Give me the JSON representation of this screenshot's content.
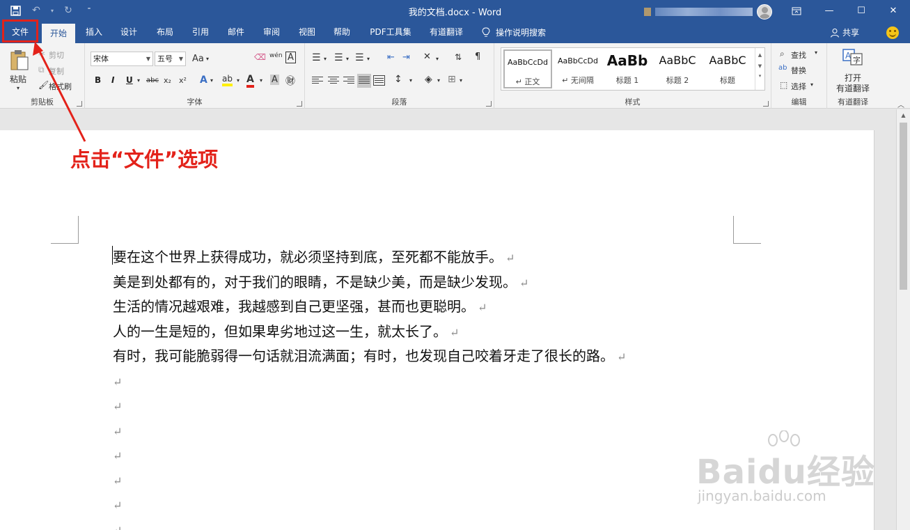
{
  "title_bar": {
    "document_title": "我的文档.docx - Word",
    "restore_icon": "ribbon-display-icon",
    "minimize": "—",
    "maximize": "☐",
    "close": "✕"
  },
  "tabs": [
    "文件",
    "开始",
    "插入",
    "设计",
    "布局",
    "引用",
    "邮件",
    "审阅",
    "视图",
    "帮助",
    "PDF工具集",
    "有道翻译"
  ],
  "active_tab": "开始",
  "tell_me": "操作说明搜索",
  "share": "共享",
  "ribbon": {
    "clipboard": {
      "label": "剪贴板",
      "paste": "粘贴",
      "cut": "剪切",
      "copy": "复制",
      "format_painter": "格式刷"
    },
    "font": {
      "label": "字体",
      "font_name": "宋体",
      "font_size": "五号",
      "bold": "B",
      "italic": "I",
      "underline": "U",
      "strike": "abc",
      "subscript": "x₂",
      "superscript": "x²",
      "grow": "Aa",
      "phonetic": "wén",
      "box": "A"
    },
    "paragraph": {
      "label": "段落"
    },
    "styles": {
      "label": "样式",
      "items": [
        {
          "sample": "AaBbCcDd",
          "name": "正文"
        },
        {
          "sample": "AaBbCcDd",
          "name": "无间隔"
        },
        {
          "sample": "AaBb",
          "name": "标题 1"
        },
        {
          "sample": "AaBbC",
          "name": "标题 2"
        },
        {
          "sample": "AaBbC",
          "name": "标题"
        }
      ]
    },
    "editing": {
      "label": "编辑",
      "find": "查找",
      "replace": "替换",
      "select": "选择"
    },
    "youdao": {
      "label": "有道翻译",
      "open_line1": "打开",
      "open_line2": "有道翻译"
    }
  },
  "document": {
    "lines": [
      "要在这个世界上获得成功，就必须坚持到底，至死都不能放手。",
      "美是到处都有的，对于我们的眼睛，不是缺少美，而是缺少发现。",
      "生活的情况越艰难，我越感到自己更坚强，甚而也更聪明。",
      "人的一生是短的，但如果卑劣地过这一生，就太长了。",
      "有时，我可能脆弱得一句话就泪流满面；有时，也发现自己咬着牙走了很长的路。",
      "",
      "",
      "",
      "",
      "",
      "",
      ""
    ],
    "paragraph_mark": "↵"
  },
  "annotation": {
    "text": "点击“文件”选项",
    "color": "#e3221a"
  },
  "watermark": {
    "logo": "Baidu经验",
    "url": "jingyan.baidu.com"
  },
  "colors": {
    "title_bar": "#2b579a",
    "ribbon": "#f3f3f3",
    "accent_red": "#e3221a"
  }
}
